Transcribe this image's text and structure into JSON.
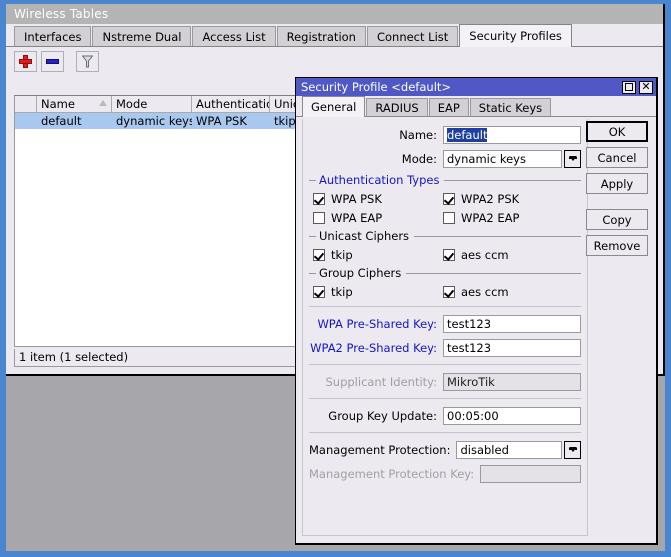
{
  "window": {
    "title": "Wireless Tables",
    "tabs": [
      {
        "label": "Interfaces",
        "active": false
      },
      {
        "label": "Nstreme Dual",
        "active": false
      },
      {
        "label": "Access List",
        "active": false
      },
      {
        "label": "Registration",
        "active": false
      },
      {
        "label": "Connect List",
        "active": false
      },
      {
        "label": "Security Profiles",
        "active": true
      }
    ],
    "toolbar": [
      {
        "name": "add-button",
        "icon": "plus-icon"
      },
      {
        "name": "remove-button",
        "icon": "minus-icon"
      },
      {
        "name": "filter-button",
        "icon": "funnel-icon"
      }
    ],
    "table": {
      "columns": [
        "",
        "Name",
        "Mode",
        "Authenticatio...",
        "Unic",
        "",
        ""
      ],
      "sorted_column": "Name",
      "rows": [
        {
          "flag": "",
          "name": "default",
          "mode": "dynamic keys",
          "authentication": "WPA PSK",
          "unicast": "tkip",
          "extra1": "",
          "extra2": ""
        }
      ]
    },
    "status": "1 item (1 selected)"
  },
  "dialog": {
    "title": "Security Profile <default>",
    "titlebar_buttons": [
      {
        "name": "maximize-button",
        "icon": "maximize-icon"
      },
      {
        "name": "close-button",
        "icon": "close-icon"
      }
    ],
    "tabs": [
      {
        "label": "General",
        "active": true
      },
      {
        "label": "RADIUS",
        "active": false
      },
      {
        "label": "EAP",
        "active": false
      },
      {
        "label": "Static Keys",
        "active": false
      }
    ],
    "fields": {
      "name_label": "Name:",
      "name_value": "default",
      "mode_label": "Mode:",
      "mode_value": "dynamic keys",
      "wpa_psk_label": "WPA Pre-Shared Key:",
      "wpa_psk_value": "test123",
      "wpa2_psk_label": "WPA2 Pre-Shared Key:",
      "wpa2_psk_value": "test123",
      "supplicant_label": "Supplicant Identity:",
      "supplicant_value": "MikroTik",
      "group_key_label": "Group Key Update:",
      "group_key_value": "00:05:00",
      "mgmt_protection_label": "Management Protection:",
      "mgmt_protection_value": "disabled",
      "mgmt_protection_key_label": "Management Protection Key:",
      "mgmt_protection_key_value": ""
    },
    "groups": [
      {
        "legend": "Authentication Types",
        "legend_color": "#1414c8",
        "checkboxes": [
          {
            "label": "WPA PSK",
            "checked": true
          },
          {
            "label": "WPA2 PSK",
            "checked": true
          },
          {
            "label": "WPA EAP",
            "checked": false
          },
          {
            "label": "WPA2 EAP",
            "checked": false
          }
        ]
      },
      {
        "legend": "Unicast Ciphers",
        "legend_color": "#000000",
        "checkboxes": [
          {
            "label": "tkip",
            "checked": true
          },
          {
            "label": "aes ccm",
            "checked": true
          }
        ]
      },
      {
        "legend": "Group Ciphers",
        "legend_color": "#000000",
        "checkboxes": [
          {
            "label": "tkip",
            "checked": true
          },
          {
            "label": "aes ccm",
            "checked": true
          }
        ]
      }
    ],
    "buttons": [
      {
        "label": "OK",
        "default": true
      },
      {
        "label": "Cancel",
        "default": false
      },
      {
        "label": "Apply",
        "default": false
      },
      {
        "label": "Copy",
        "default": false
      },
      {
        "label": "Remove",
        "default": false
      }
    ]
  },
  "colors": {
    "accent_blue": "#4a85cf",
    "dialog_title": "#4f58c4",
    "selection": "#a8c8f0",
    "label_blue": "#1414c8",
    "desktop": "#a6a6ab"
  }
}
